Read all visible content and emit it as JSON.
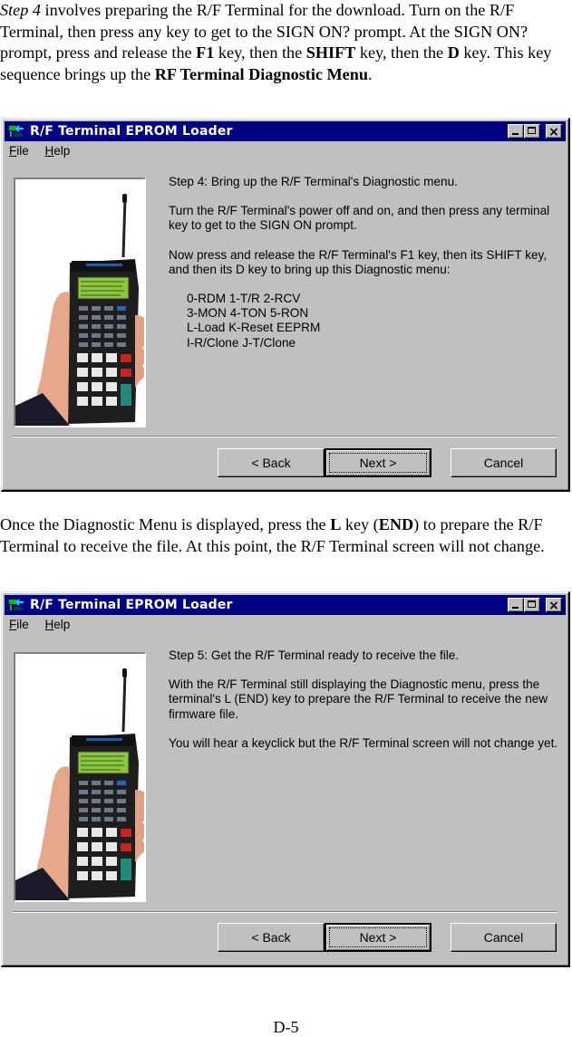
{
  "intro": {
    "step_label": "Step 4",
    "t1": " involves preparing the R/F Terminal for the download.  Turn on the R/F Terminal, then press any key to get to the SIGN ON? prompt. At the SIGN ON? prompt, press and release the ",
    "k1": "F1",
    "t2": " key, then the ",
    "k2": "SHIFT",
    "t3": " key, then the ",
    "k3": "D",
    "t4": " key. This key sequence brings up the ",
    "k4": "RF Terminal Diagnostic Menu",
    "t5": "."
  },
  "middle": {
    "t1": "Once the Diagnostic Menu is displayed, press the ",
    "k1": "L",
    "t2": " key (",
    "k2": "END",
    "t3": ") to prepare the R/F Terminal to receive the file.  At this point, the R/F Terminal screen will not change."
  },
  "window1": {
    "title": "R/F Terminal EPROM Loader",
    "menu": [
      "File",
      "Help"
    ],
    "heading": "Step 4: Bring up the R/F Terminal's Diagnostic menu.",
    "p1": "Turn the R/F Terminal's power off and on, and then press any terminal key to get to the SIGN ON prompt.",
    "p2": "Now press and release the R/F Terminal's F1 key, then its SHIFT key, and then its D key to bring up this Diagnostic menu:",
    "menu_lines": [
      "0-RDM 1-T/R 2-RCV",
      "3-MON 4-TON 5-RON",
      "L-Load K-Reset EEPRM",
      "I-R/Clone J-T/Clone"
    ],
    "buttons": {
      "back": "< Back",
      "next": "Next >",
      "cancel": "Cancel"
    }
  },
  "window2": {
    "title": "R/F Terminal EPROM Loader",
    "menu": [
      "File",
      "Help"
    ],
    "heading": "Step 5: Get the R/F Terminal ready to receive the file.",
    "p1": "With the R/F Terminal still displaying the Diagnostic menu, press the terminal's L (END) key to prepare the R/F Terminal to receive the new firmware file.",
    "p2": "You will hear a keyclick but the R/F Terminal screen will not change yet.",
    "buttons": {
      "back": "< Back",
      "next": "Next >",
      "cancel": "Cancel"
    }
  },
  "footer": {
    "page_number": "D-5"
  }
}
